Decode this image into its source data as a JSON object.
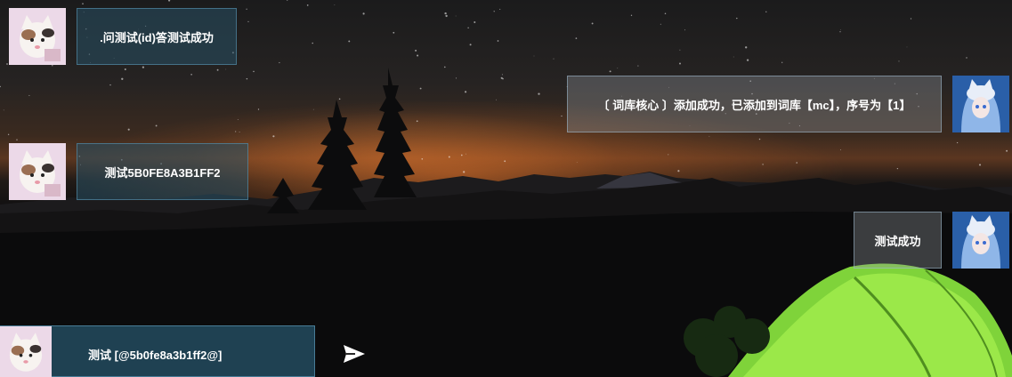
{
  "messages": [
    {
      "side": "left",
      "text": ".问测试(id)答测试成功"
    },
    {
      "side": "right",
      "text": "〔 词库核心 〕添加成功，已添加到词库【mc】，序号为【1】"
    },
    {
      "side": "left",
      "text": "测试5B0FE8A3B1FF2"
    },
    {
      "side": "right",
      "text": "测试成功"
    }
  ],
  "composer": {
    "text": "测试 [@5b0fe8a3b1ff2@]",
    "send_icon": "send-icon"
  },
  "colors": {
    "bubble_border": "#a0bed2",
    "composer_bg": "#234b5f",
    "sunset": "#d66b26",
    "tent": "#8ee53a"
  }
}
